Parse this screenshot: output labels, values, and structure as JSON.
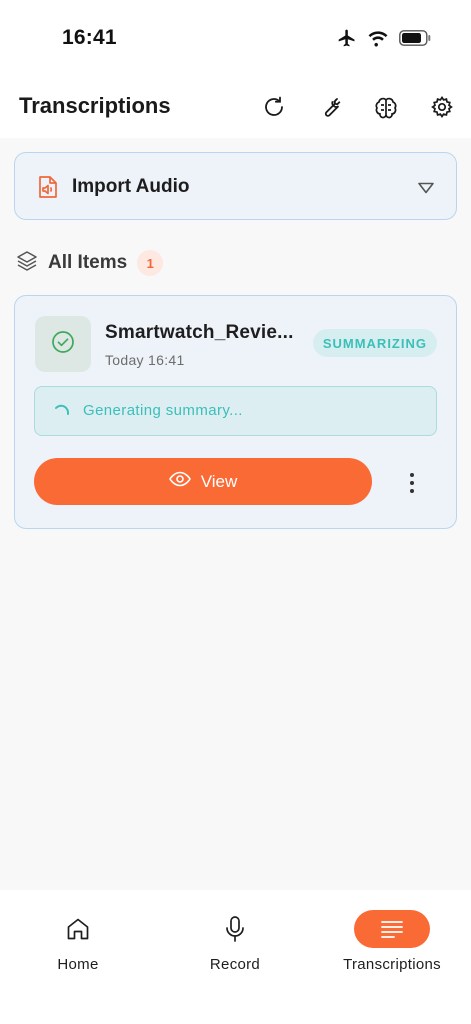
{
  "status_bar": {
    "time": "16:41",
    "icons": [
      "airplane-icon",
      "wifi-icon",
      "battery-icon"
    ]
  },
  "header": {
    "title": "Transcriptions",
    "actions": [
      "refresh-icon",
      "wrench-icon",
      "brain-icon",
      "gear-icon"
    ]
  },
  "import": {
    "label": "Import Audio",
    "icon": "audio-file-icon"
  },
  "section": {
    "title": "All Items",
    "count": "1"
  },
  "items": [
    {
      "name": "Smartwatch_Revie...",
      "date": "Today 16:41",
      "status": "SUMMARIZING",
      "progress_text": "Generating summary...",
      "view_label": "View"
    }
  ],
  "tabs": [
    {
      "label": "Home",
      "icon": "home-icon",
      "active": false
    },
    {
      "label": "Record",
      "icon": "microphone-icon",
      "active": false
    },
    {
      "label": "Transcriptions",
      "icon": "lines-icon",
      "active": true
    }
  ],
  "colors": {
    "accent": "#fa6a35",
    "teal": "#3bbfb9",
    "card_bg": "#eef3f9",
    "card_border": "#b9d6ee"
  }
}
